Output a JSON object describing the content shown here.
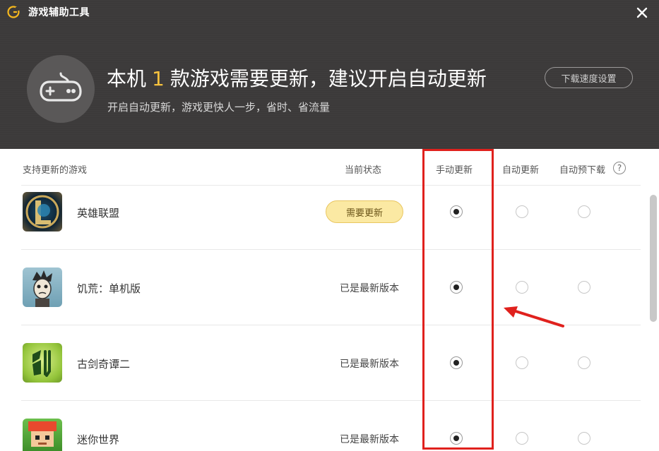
{
  "window": {
    "title": "游戏辅助工具",
    "close_icon": "close-icon"
  },
  "banner": {
    "headline_prefix": "本机",
    "update_count": "1",
    "headline_suffix": "款游戏需要更新，建议开启自动更新",
    "subline": "开启自动更新，游戏更快人一步，省时、省流量",
    "speed_settings_label": "下载速度设置",
    "count_color": "#f6c23e"
  },
  "table": {
    "columns": {
      "game": "支持更新的游戏",
      "status": "当前状态",
      "manual": "手动更新",
      "auto": "自动更新",
      "predownload": "自动预下载"
    },
    "help_label": "?",
    "rows": [
      {
        "name": "英雄联盟",
        "status": "需要更新",
        "needs_update": true,
        "mode": "manual"
      },
      {
        "name": "饥荒：单机版",
        "status": "已是最新版本",
        "needs_update": false,
        "mode": "manual"
      },
      {
        "name": "古剑奇谭二",
        "status": "已是最新版本",
        "needs_update": false,
        "mode": "manual"
      },
      {
        "name": "迷你世界",
        "status": "已是最新版本",
        "needs_update": false,
        "mode": "manual"
      }
    ]
  },
  "annotation": {
    "highlight_color": "#e0211d"
  }
}
